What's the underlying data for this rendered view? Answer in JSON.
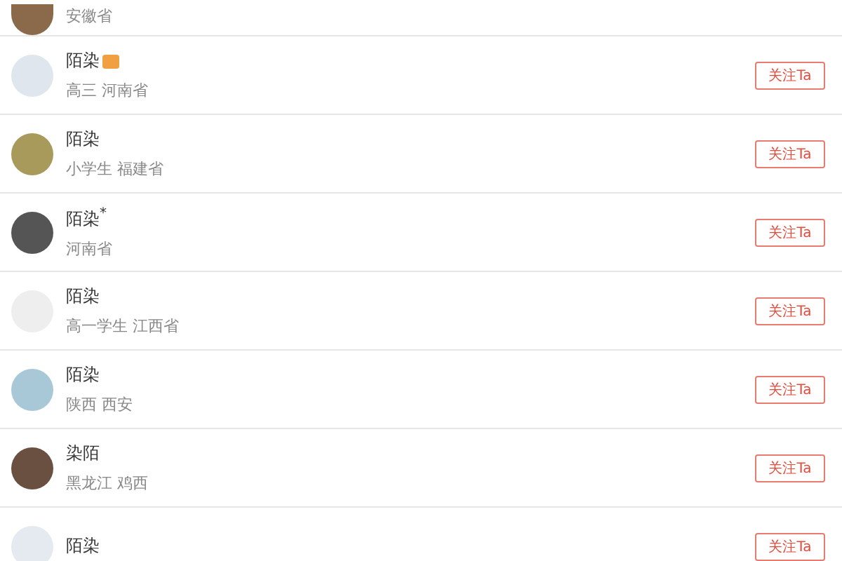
{
  "users": [
    {
      "subtitle": "安徽省"
    },
    {
      "name": "陌染",
      "subtitle": "高三  河南省",
      "badge": true,
      "follow": "关注Ta"
    },
    {
      "name": "陌染",
      "subtitle": "小学生  福建省",
      "badge": false,
      "follow": "关注Ta"
    },
    {
      "name": "陌染$^{*}$",
      "subtitle": "河南省",
      "badge": false,
      "follow": "关注Ta"
    },
    {
      "name": "陌染",
      "subtitle": "高一学生  江西省",
      "badge": false,
      "follow": "关注Ta"
    },
    {
      "name": "陌染",
      "subtitle": "陕西  西安",
      "badge": false,
      "follow": "关注Ta"
    },
    {
      "name": "染陌",
      "subtitle": "黑龙江  鸡西",
      "badge": false,
      "follow": "关注Ta"
    },
    {
      "name": "陌染",
      "badge": false,
      "follow": "关注Ta"
    }
  ]
}
